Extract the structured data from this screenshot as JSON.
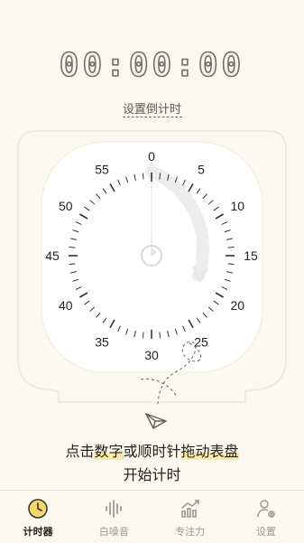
{
  "timer": {
    "display": "00:00:00"
  },
  "set_countdown_label": "设置倒计时",
  "dial": {
    "numbers": [
      "0",
      "5",
      "10",
      "15",
      "20",
      "25",
      "30",
      "35",
      "40",
      "45",
      "50",
      "55"
    ]
  },
  "hint": {
    "line1_plain_a": "点击",
    "line1_highlight_a": "数字",
    "line1_plain_b": "或顺时针",
    "line1_highlight_b": "拖动表盘",
    "line2": "开始计时"
  },
  "tabs": [
    {
      "label": "计时器",
      "icon": "clock-icon",
      "active": true
    },
    {
      "label": "白噪音",
      "icon": "soundwave-icon",
      "active": false
    },
    {
      "label": "专注力",
      "icon": "chart-icon",
      "active": false
    },
    {
      "label": "设置",
      "icon": "settings-icon",
      "active": false
    }
  ],
  "colors": {
    "accent": "#f5d76e",
    "background": "#fbf8ef"
  }
}
